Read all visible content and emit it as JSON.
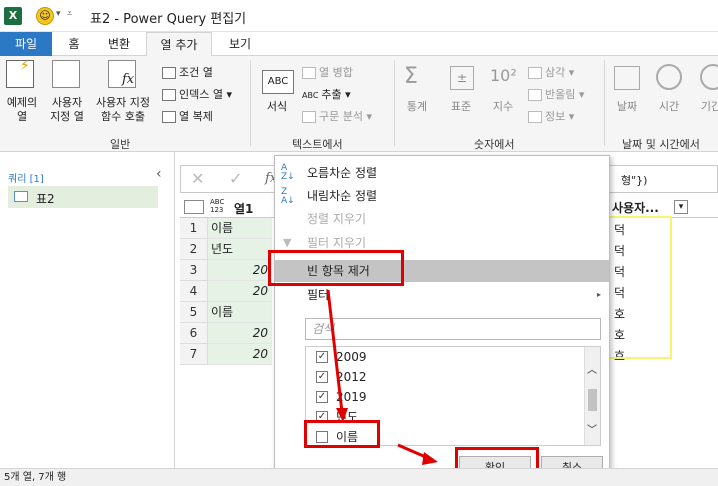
{
  "titlebar": {
    "app_icon": "X",
    "title": "표2 - Power Query 편집기"
  },
  "tabs": [
    {
      "label": "파일"
    },
    {
      "label": "홈"
    },
    {
      "label": "변환"
    },
    {
      "label": "열 추가"
    },
    {
      "label": "보기"
    }
  ],
  "ribbon": {
    "general": {
      "label": "일반",
      "example_col": "예제의\n열",
      "custom_col": "사용자\n지정 열",
      "invoke_fn": "사용자 지정\n함수 호출",
      "conditional": "조건 열",
      "index": "인덱스 열",
      "duplicate": "열 복제"
    },
    "text": {
      "label": "텍스트에서",
      "format": "서식",
      "merge": "열 병합",
      "extract": "추출",
      "parse": "구문 분석"
    },
    "number": {
      "label": "숫자에서",
      "stats": "통계",
      "standard": "표준",
      "scientific": "지수",
      "trig": "삼각",
      "rounding": "반올림",
      "info": "정보"
    },
    "datetime": {
      "label": "날짜 및 시간에서",
      "date": "날짜",
      "time": "시간",
      "duration": "기간"
    }
  },
  "queries": {
    "header": "쿼리 [1]",
    "items": [
      {
        "label": "표2"
      }
    ]
  },
  "formula": {
    "fx": "fx",
    "tail": "형\"})"
  },
  "grid": {
    "col1_type": "ABC\n123",
    "col1_name": "열1",
    "col2_name": "사용자...",
    "rows": [
      {
        "n": "1",
        "v": "이름"
      },
      {
        "n": "2",
        "v": "년도"
      },
      {
        "n": "3",
        "v": "20"
      },
      {
        "n": "4",
        "v": "20"
      },
      {
        "n": "5",
        "v": "이름"
      },
      {
        "n": "6",
        "v": "20"
      },
      {
        "n": "7",
        "v": "20"
      }
    ],
    "right_col": [
      "덕",
      "덕",
      "덕",
      "덕",
      "호",
      "호",
      "호"
    ]
  },
  "menu": {
    "sort_asc": "오름차순 정렬",
    "sort_desc": "내림차순 정렬",
    "clear_sort": "정렬 지우기",
    "clear_filter": "필터 지우기",
    "remove_empty": "빈 항목 제거",
    "filter": "필터",
    "search_placeholder": "검색",
    "list": [
      {
        "label": "2009",
        "checked": true
      },
      {
        "label": "2012",
        "checked": true
      },
      {
        "label": "2019",
        "checked": true
      },
      {
        "label": "년도",
        "checked": true
      },
      {
        "label": "이름",
        "checked": false
      }
    ],
    "ok": "확인",
    "cancel": "취소"
  },
  "status": "5개 열, 7개 행",
  "colors": {
    "file_tab": "#2b78c5",
    "highlight": "#e00000",
    "yellow_box": "#f5f570",
    "row_green": "#e6f2e6"
  }
}
